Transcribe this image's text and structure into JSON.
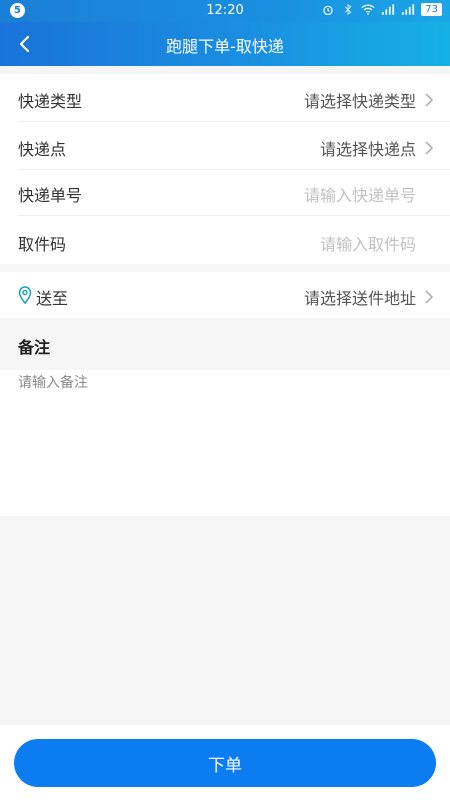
{
  "status_bar": {
    "notif_badge": "5",
    "time": "12:20",
    "battery": "73"
  },
  "header": {
    "title": "跑腿下单-取快递"
  },
  "form": {
    "express_type": {
      "label": "快递类型",
      "value": "请选择快递类型"
    },
    "express_point": {
      "label": "快递点",
      "value": "请选择快递点"
    },
    "tracking_no": {
      "label": "快递单号",
      "placeholder": "请输入快递单号"
    },
    "pickup_code": {
      "label": "取件码",
      "placeholder": "请输入取件码"
    },
    "deliver_to": {
      "label": "送至",
      "value": "请选择送件地址"
    }
  },
  "remark": {
    "title": "备注",
    "placeholder": "请输入备注"
  },
  "submit": {
    "label": "下单"
  },
  "colors": {
    "accent": "#0b7cf2",
    "header_start": "#1a73d9",
    "header_end": "#16b0e5"
  }
}
